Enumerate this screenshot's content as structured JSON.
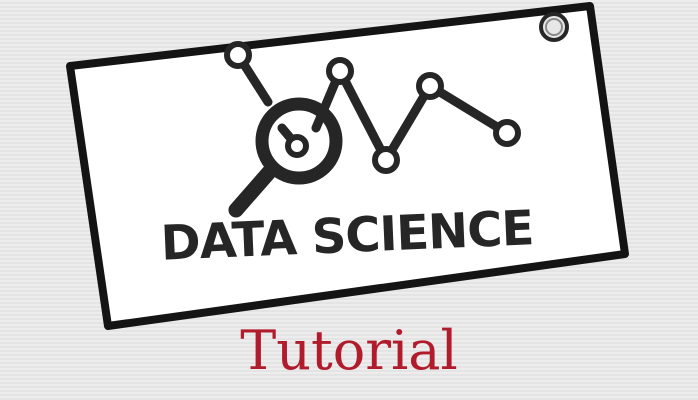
{
  "sign": {
    "headline": "DATA SCIENCE"
  },
  "caption": {
    "subtitle": "Tutorial"
  },
  "colors": {
    "background": "#ebebeb",
    "sign_fill": "#ffffff",
    "sign_border": "#141414",
    "ink": "#262626",
    "subtitle": "#b11c2c"
  },
  "icons": [
    "magnifier-icon",
    "line-graph-icon",
    "hanging-hole-icon"
  ]
}
